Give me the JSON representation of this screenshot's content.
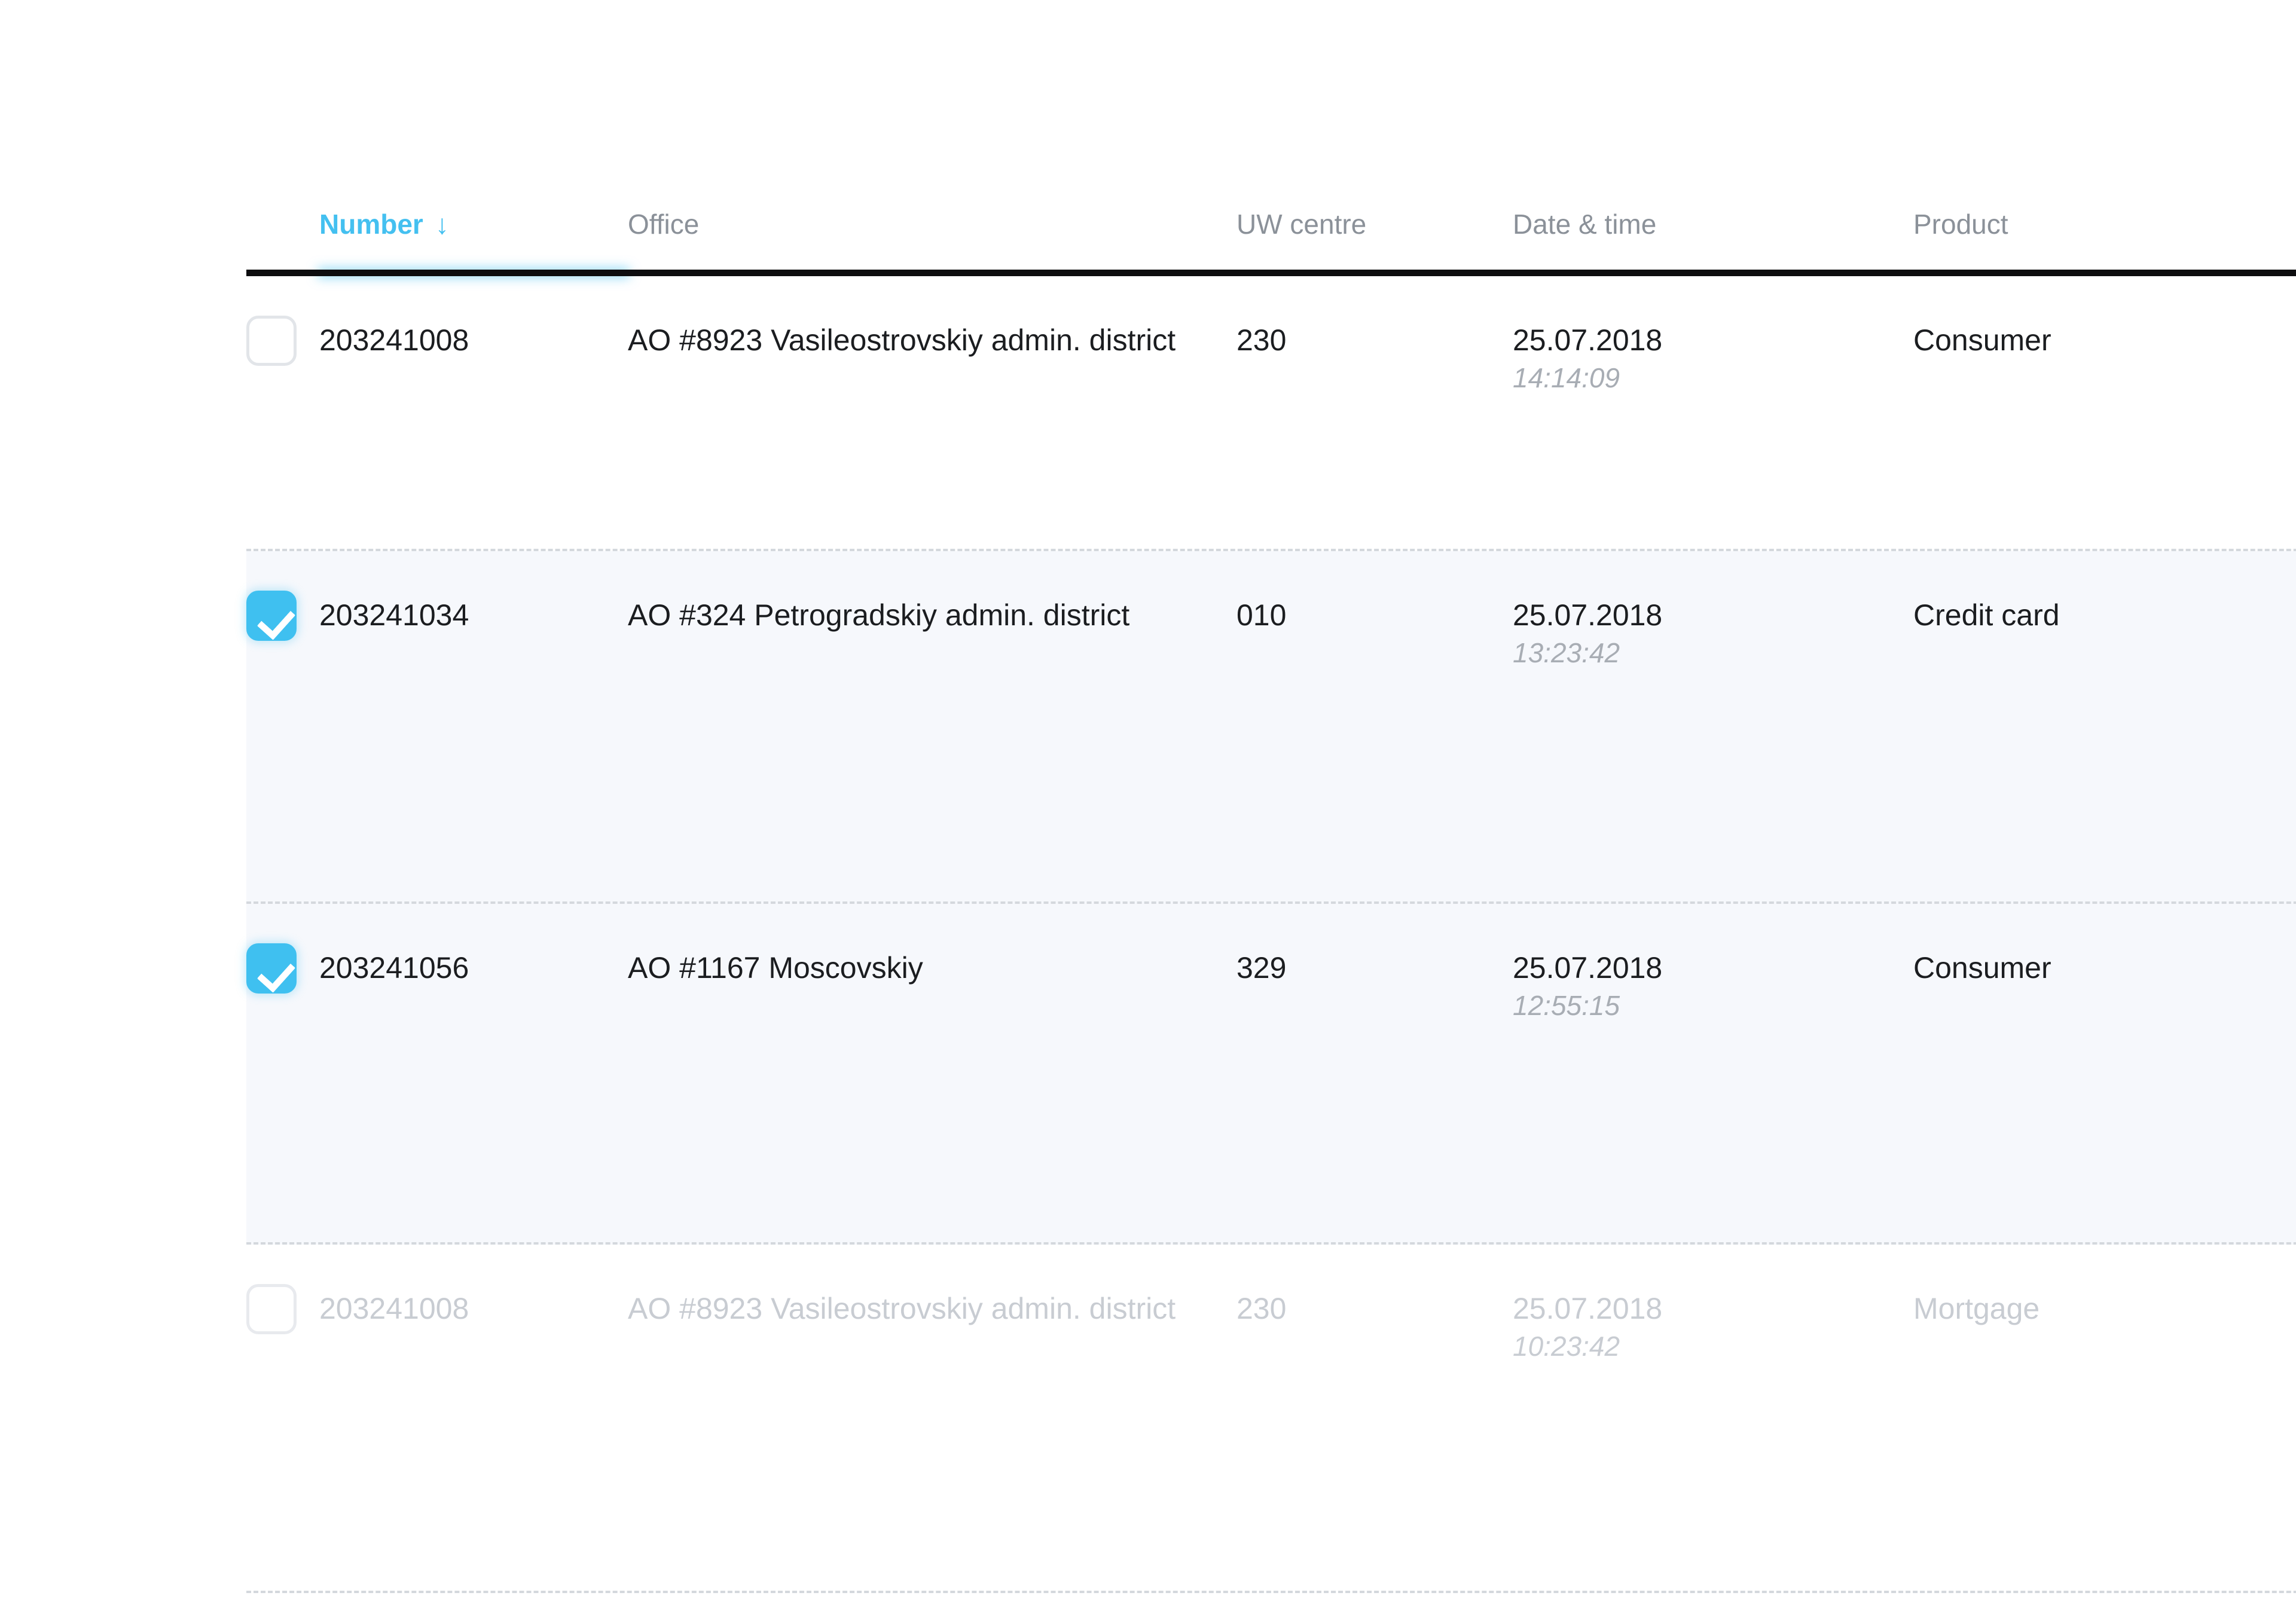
{
  "table": {
    "columns": [
      {
        "key": "checkbox",
        "label": "",
        "sorted": false
      },
      {
        "key": "number",
        "label": "Number",
        "sorted": true,
        "sort_icon": "↓"
      },
      {
        "key": "office",
        "label": "Office",
        "sorted": false
      },
      {
        "key": "uw",
        "label": "UW centre",
        "sorted": false
      },
      {
        "key": "date",
        "label": "Date & time",
        "sorted": false
      },
      {
        "key": "product",
        "label": "Product",
        "sorted": false
      }
    ],
    "rows": [
      {
        "checked": false,
        "disabled": false,
        "number": "203241008",
        "office": "AO #8923 Vasileostrovskiy admin. district",
        "uw_centre": "230",
        "date": "25.07.2018",
        "time": "14:14:09",
        "product": "Consumer"
      },
      {
        "checked": true,
        "disabled": false,
        "number": "203241034",
        "office": "AO #324 Petrogradskiy admin. district",
        "uw_centre": "010",
        "date": "25.07.2018",
        "time": "13:23:42",
        "product": "Credit card"
      },
      {
        "checked": true,
        "disabled": false,
        "number": "203241056",
        "office": "AO #1167 Moscovskiy",
        "uw_centre": "329",
        "date": "25.07.2018",
        "time": "12:55:15",
        "product": "Consumer"
      },
      {
        "checked": false,
        "disabled": true,
        "number": "203241008",
        "office": "AO #8923 Vasileostrovskiy admin. district",
        "uw_centre": "230",
        "date": "25.07.2018",
        "time": "10:23:42",
        "product": "Mortgage"
      }
    ]
  },
  "colors": {
    "accent": "#44c0f0",
    "checkbox_checked": "#3fc0f0",
    "header_rule": "#0d0d0f",
    "header_text": "#8b9199",
    "row_text": "#1b1d20",
    "sub_text": "#a8adb4",
    "disabled_text": "#c8ccd2",
    "selected_row_bg": "#f6f8fc",
    "separator": "#d4d8dd"
  }
}
